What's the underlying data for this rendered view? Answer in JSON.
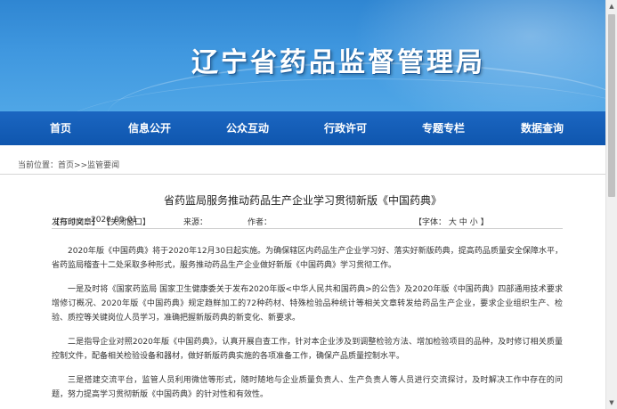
{
  "site": {
    "title": "辽宁省药品监督管理局"
  },
  "nav": {
    "items": [
      {
        "label": "首页"
      },
      {
        "label": "信息公开"
      },
      {
        "label": "公众互动"
      },
      {
        "label": "行政许可"
      },
      {
        "label": "专题专栏"
      },
      {
        "label": "数据查询"
      }
    ]
  },
  "breadcrumb": {
    "prefix": "当前位置：",
    "home": "首页",
    "sep": ">>",
    "section": "监管要闻"
  },
  "article": {
    "title": "省药监局服务推动药品生产企业学习贯彻新版《中国药典》",
    "publish_label": "发布时间：",
    "publish_date": "2020-09-01",
    "source_label": "来源：",
    "author_label": "作者：",
    "font_label": "【字体：",
    "font_large": "大",
    "font_medium": "中",
    "font_small": "小",
    "font_close": "】",
    "print_label": "【打印文章】",
    "close_label": "【关闭窗口】",
    "paragraphs": [
      "2020年版《中国药典》将于2020年12月30日起实施。为确保辖区内药品生产企业学习好、落实好新版药典，提高药品质量安全保障水平，省药监局稽查十二处采取多种形式，服务推动药品生产企业做好新版《中国药典》学习贯彻工作。",
      "一是及时将《国家药监局 国家卫生健康委关于发布2020年版<中华人民共和国药典>的公告》及2020年版《中国药典》四部通用技术要求增修订概况、2020年版《中国药典》规定趋鲜加工的72种药材、特殊检验品种统计等相关文章转发给药品生产企业，要求企业组织生产、检验、质控等关键岗位人员学习，准确把握新版药典的新变化、新要求。",
      "二是指导企业对照2020年版《中国药典》，认真开展自查工作，针对本企业涉及到调整检验方法、增加检验项目的品种，及时修订相关质量控制文件，配备相关检验设备和器材，做好新版药典实施的各项准备工作，确保产品质量控制水平。",
      "三是搭建交流平台，监管人员利用微信等形式，随时随地与企业质量负责人、生产负责人等人员进行交流探讨，及时解决工作中存在的问题，努力提高学习贯彻新版《中国药典》的针对性和有效性。"
    ]
  },
  "scrollbar": {
    "up_icon": "▲",
    "down_icon": "▼"
  },
  "colors": {
    "banner": "#3f97df",
    "nav": "#1560b8"
  }
}
